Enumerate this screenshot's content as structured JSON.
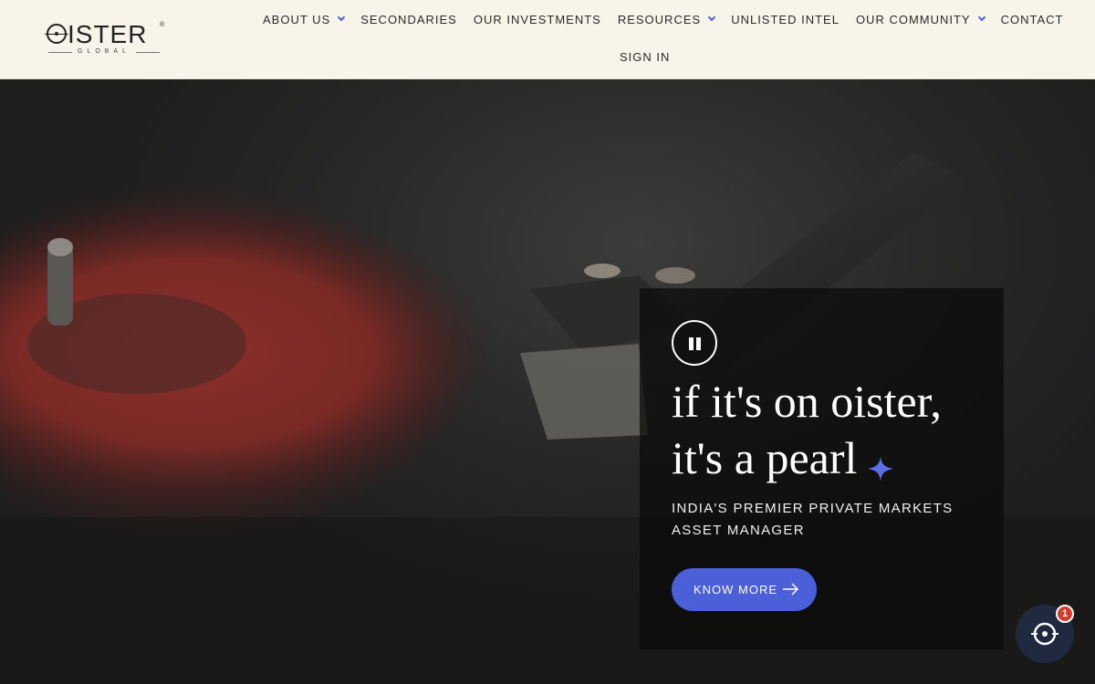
{
  "brand": {
    "logo_text": "OISTER",
    "logo_subtext": "GLOBAL",
    "logo_mark": "®"
  },
  "nav": {
    "items": [
      {
        "label": "ABOUT US",
        "has_dropdown": true
      },
      {
        "label": "SECONDARIES",
        "has_dropdown": false
      },
      {
        "label": "OUR INVESTMENTS",
        "has_dropdown": false
      },
      {
        "label": "RESOURCES",
        "has_dropdown": true
      },
      {
        "label": "UNLISTED INTEL",
        "has_dropdown": false
      },
      {
        "label": "OUR COMMUNITY",
        "has_dropdown": true
      },
      {
        "label": "CONTACT",
        "has_dropdown": false
      }
    ],
    "signin_label": "SIGN IN"
  },
  "hero": {
    "headline_line1": "if it's on oister,",
    "headline_line2": "it's a pearl",
    "tagline": "INDIA'S PREMIER PRIVATE MARKETS ASSET MANAGER",
    "cta_label": "KNOW MORE",
    "pause_icon": "pause-icon",
    "sparkle_icon": "sparkle-icon",
    "arrow_icon": "arrow-right-icon"
  },
  "chat": {
    "badge_count": "1",
    "icon": "chat-icon"
  },
  "colors": {
    "header_bg": "#f9f4ea",
    "accent": "#4a5fd8",
    "badge": "#d43b2f"
  }
}
